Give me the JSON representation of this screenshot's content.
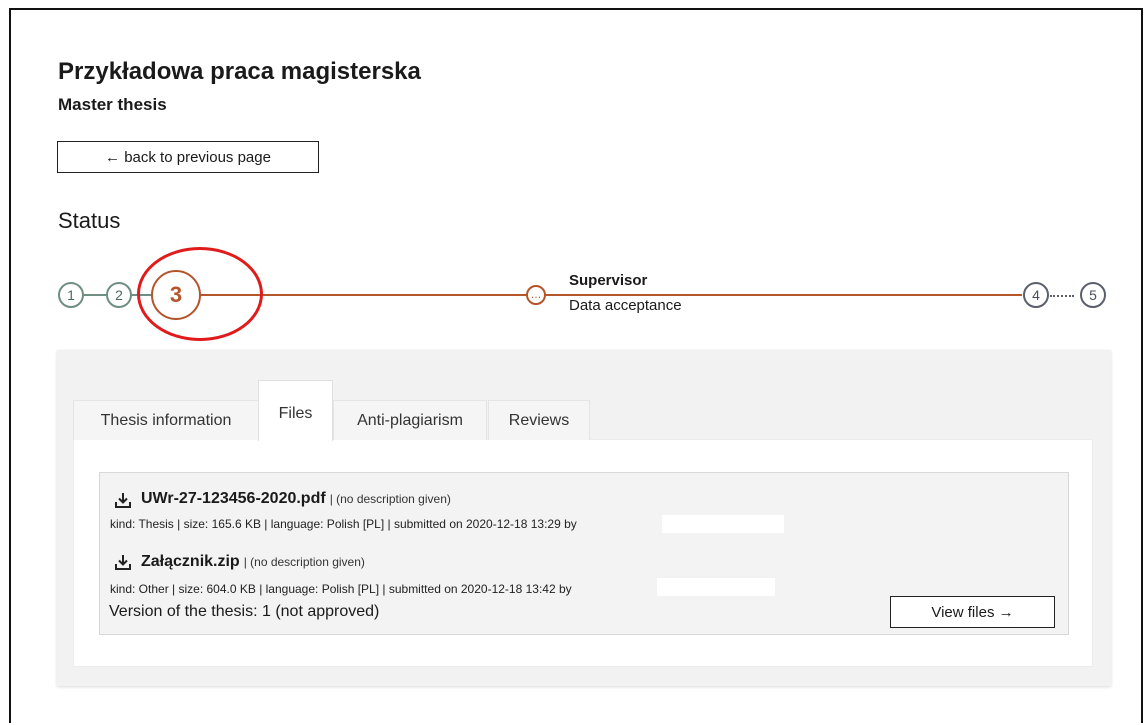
{
  "header": {
    "title": "Przykładowa praca magisterska",
    "subtitle": "Master thesis",
    "back_label": "← back to previous page"
  },
  "status": {
    "heading": "Status",
    "steps": [
      {
        "label": "1",
        "state": "done"
      },
      {
        "label": "2",
        "state": "done"
      },
      {
        "label": "3",
        "state": "current"
      },
      {
        "label": "4",
        "state": "future"
      },
      {
        "label": "5",
        "state": "future"
      }
    ],
    "substep_icon": "…",
    "substep_role": "Supervisor",
    "substep_name": "Data acceptance"
  },
  "tabs": [
    {
      "label": "Thesis information",
      "active": false
    },
    {
      "label": "Files",
      "active": true
    },
    {
      "label": "Anti-plagiarism",
      "active": false
    },
    {
      "label": "Reviews",
      "active": false
    }
  ],
  "files": [
    {
      "name": "UWr-27-123456-2020.pdf",
      "desc": "| (no description given)",
      "meta": "kind: Thesis | size: 165.6 KB | language: Polish [PL] | submitted on 2020-12-18 13:29 by"
    },
    {
      "name": "Załącznik.zip",
      "desc": "| (no description given)",
      "meta": "kind: Other | size: 604.0 KB | language: Polish [PL] | submitted on 2020-12-18 13:42 by"
    }
  ],
  "version_text": "Version of the thesis: 1 (not approved)",
  "view_files_label": "View files →",
  "colors": {
    "current_step": "#b5552b",
    "done_step": "#6f8e82",
    "future_step": "#5a5f6b",
    "annotation": "#e01b1b"
  }
}
